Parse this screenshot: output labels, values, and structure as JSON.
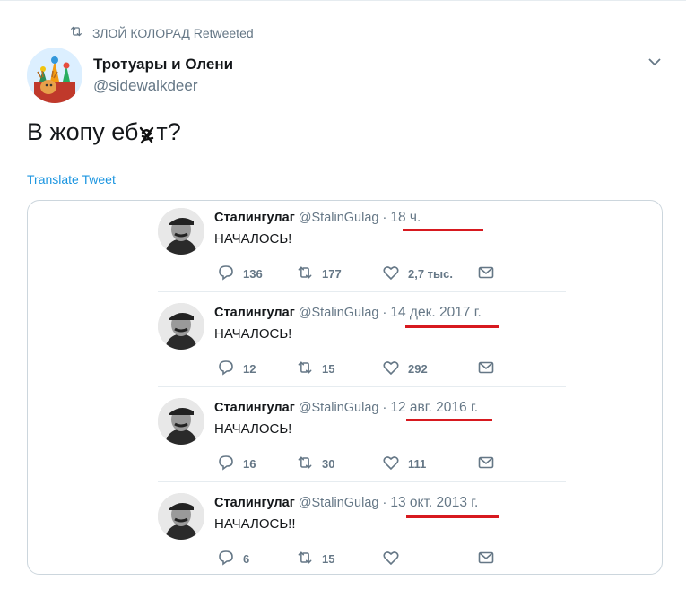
{
  "retweet": {
    "icon": "retweet-icon",
    "text": "ЗЛОЙ КОЛОРАД Retweeted"
  },
  "author": {
    "name": "Тротуары и Олени",
    "handle": "@sidewalkdeer"
  },
  "tweet": {
    "text_before": "В жопу еб",
    "text_after": "т?",
    "censor_icon": "scribble-icon"
  },
  "translate_label": "Translate Tweet",
  "colors": {
    "link": "#1b95e0",
    "secondary": "#657786",
    "underline": "#d7191f",
    "border": "#ccd6dd"
  },
  "quoted": [
    {
      "name": "Сталингулаг",
      "handle": "@StalinGulag",
      "dot": "·",
      "date": "18 ч.",
      "text": "НАЧАЛОСЬ!",
      "replies": "136",
      "retweets": "177",
      "likes": "2,7 тыс."
    },
    {
      "name": "Сталингулаг",
      "handle": "@StalinGulag",
      "dot": "·",
      "date": "14 дек. 2017 г.",
      "text": "НАЧАЛОСЬ!",
      "replies": "12",
      "retweets": "15",
      "likes": "292"
    },
    {
      "name": "Сталингулаг",
      "handle": "@StalinGulag",
      "dot": "·",
      "date": "12 авг. 2016 г.",
      "text": "НАЧАЛОСЬ!",
      "replies": "16",
      "retweets": "30",
      "likes": "111"
    },
    {
      "name": "Сталингулаг",
      "handle": "@StalinGulag",
      "dot": "·",
      "date": "13 окт. 2013 г.",
      "text": "НАЧАЛОСЬ!!",
      "replies": "6",
      "retweets": "15",
      "likes": ""
    }
  ]
}
